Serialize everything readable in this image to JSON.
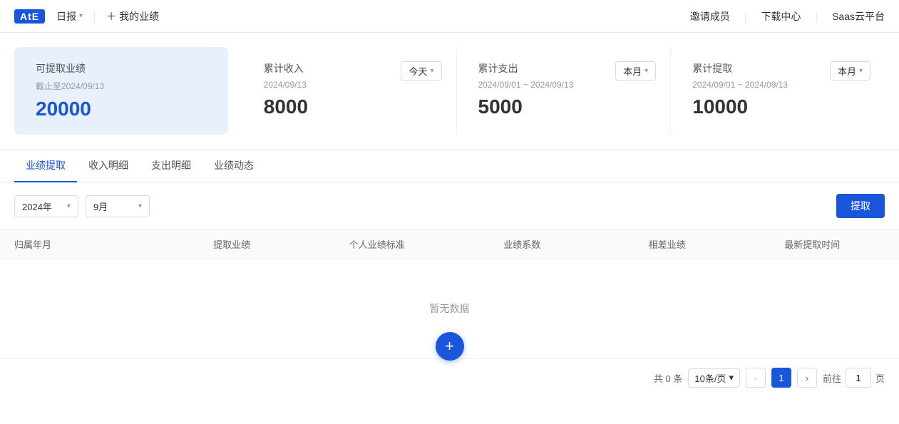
{
  "logo": {
    "text": "AtE"
  },
  "topNav": {
    "leftItems": [
      {
        "label": "日报",
        "hasArrow": true
      },
      {
        "label": "我的业绩",
        "hasPlus": true
      }
    ],
    "rightItems": [
      {
        "label": "邀请成员"
      },
      {
        "label": "下载中心"
      },
      {
        "label": "Saas云平台"
      }
    ]
  },
  "stats": {
    "card1": {
      "label": "可提取业绩",
      "date": "截止至2024/09/13",
      "value": "20000"
    },
    "card2": {
      "label": "累计收入",
      "date": "2024/09/13",
      "value": "8000",
      "dropdownLabel": "今天"
    },
    "card3": {
      "label": "累计支出",
      "date": "2024/09/01 ~ 2024/09/13",
      "value": "5000",
      "dropdownLabel": "本月"
    },
    "card4": {
      "label": "累计提取",
      "date": "2024/09/01 ~ 2024/09/13",
      "value": "10000",
      "dropdownLabel": "本月"
    }
  },
  "tabs": [
    {
      "label": "业绩提取",
      "active": true
    },
    {
      "label": "收入明细",
      "active": false
    },
    {
      "label": "支出明细",
      "active": false
    },
    {
      "label": "业绩动态",
      "active": false
    }
  ],
  "filter": {
    "yearLabel": "2024年",
    "monthLabel": "9月",
    "extractBtnLabel": "提取"
  },
  "table": {
    "columns": [
      "归属年月",
      "提取业绩",
      "个人业绩标准",
      "业绩系数",
      "相差业绩",
      "最新提取时间"
    ],
    "emptyText": "暂无数据"
  },
  "pagination": {
    "totalText": "共 0 条",
    "pageSizeLabel": "10条/页",
    "prevLabel": "<",
    "nextLabel": ">",
    "currentPage": "1",
    "gotoPrefix": "前往",
    "gotoSuffix": "页",
    "pageInput": "1"
  },
  "fab": {
    "icon": "+"
  }
}
